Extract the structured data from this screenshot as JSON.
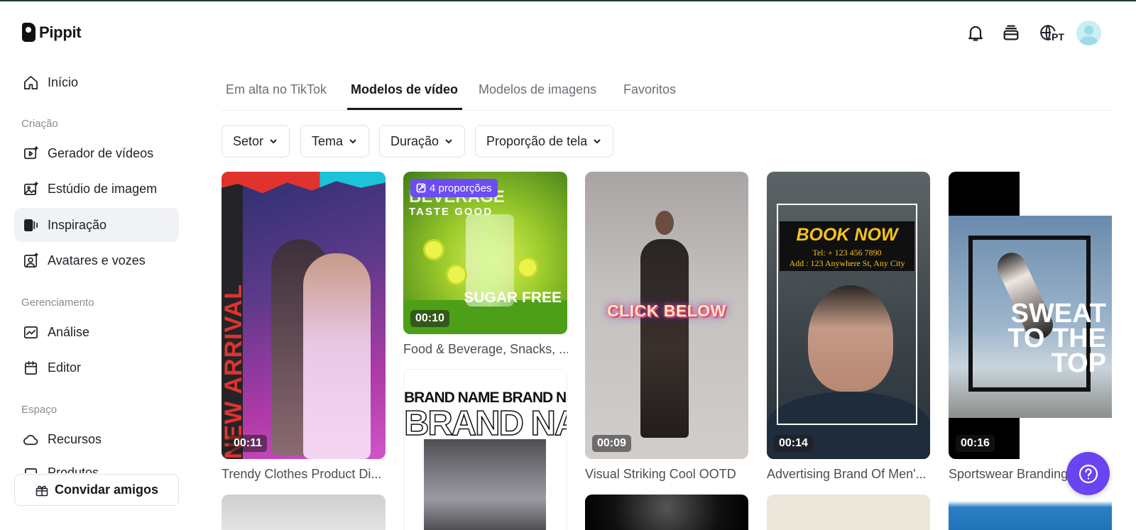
{
  "app": {
    "name": "Pippit"
  },
  "header": {
    "language": "PT"
  },
  "sidebar": {
    "home": "Início",
    "sections": [
      {
        "title": "Criação",
        "items": [
          "Gerador de vídeos",
          "Estúdio de imagem",
          "Inspiração",
          "Avatares e vozes"
        ]
      },
      {
        "title": "Gerenciamento",
        "items": [
          "Análise",
          "Editor"
        ]
      },
      {
        "title": "Espaço",
        "items": [
          "Recursos",
          "Produtos"
        ]
      }
    ],
    "active_item": "Inspiração",
    "invite_label": "Convidar amigos"
  },
  "tabs": {
    "items": [
      "Em alta no TikTok",
      "Modelos de vídeo",
      "Modelos de imagens",
      "Favoritos"
    ],
    "active": "Modelos de vídeo"
  },
  "filters": [
    "Setor",
    "Tema",
    "Duração",
    "Proporção de tela"
  ],
  "cards": [
    {
      "title": "Trendy Clothes Product Di...",
      "duration": "00:11",
      "art_text": "NEW ARRIVAL"
    },
    {
      "title": "Food & Beverage, Snacks, ...",
      "duration": "00:10",
      "badge": "4 proporções",
      "art_text_top": "BEVERAGE",
      "art_text_sub": "TASTE GOOD",
      "art_text_side": "SUGAR FREE"
    },
    {
      "title": "",
      "art_text_small": "BRAND NAME BRAND NAME BRAN",
      "art_text_big": "BRAND NAME"
    },
    {
      "title": "Visual Striking Cool OOTD",
      "duration": "00:09",
      "art_text": "CLICK BELOW"
    },
    {
      "title": "Advertising Brand Of Men'...",
      "duration": "00:14",
      "art_text": "BOOK NOW",
      "art_info": [
        "Tel: + 123 456 7890",
        "Add : 123 Anywhere St, Any City"
      ]
    },
    {
      "title": "Sportswear Branding",
      "duration": "00:16",
      "art_text": [
        "SWEAT",
        "TO THE",
        "TOP"
      ]
    }
  ],
  "colors": {
    "accent": "#6a44f2",
    "active_nav_bg": "#f1f2f4",
    "border": "#e1e3e7"
  }
}
